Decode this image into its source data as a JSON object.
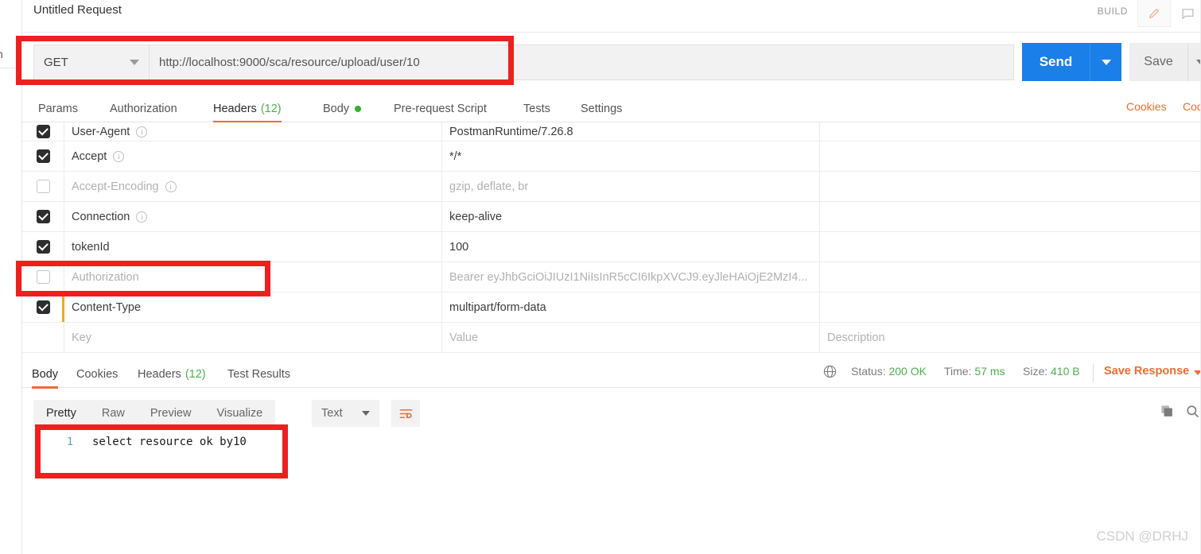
{
  "app": {
    "request_title": "Untitled Request",
    "build_label": "BUILD",
    "watermark": "CSDN @DRHJ",
    "rail_text": "n",
    "accent_orange": "#ef6c34",
    "accent_blue": "#1a7fe8",
    "accent_green": "#4caf50",
    "annotation_red": "#f01f1f"
  },
  "url_bar": {
    "method": "GET",
    "url": "http://localhost:9000/sca/resource/upload/user/10",
    "send_label": "Send",
    "save_label": "Save"
  },
  "request_tabs": [
    {
      "label": "Params",
      "active": false,
      "count": "",
      "dot": false
    },
    {
      "label": "Authorization",
      "active": false,
      "count": "",
      "dot": false
    },
    {
      "label": "Headers",
      "active": true,
      "count": "(12)",
      "dot": false
    },
    {
      "label": "Body",
      "active": false,
      "count": "",
      "dot": true
    },
    {
      "label": "Pre-request Script",
      "active": false,
      "count": "",
      "dot": false
    },
    {
      "label": "Tests",
      "active": false,
      "count": "",
      "dot": false
    },
    {
      "label": "Settings",
      "active": false,
      "count": "",
      "dot": false
    }
  ],
  "right_links": [
    {
      "label": "Cookies"
    },
    {
      "label": "Cod"
    }
  ],
  "headers_table": {
    "columns": {
      "key": "Key",
      "value": "Value",
      "description": "Description"
    },
    "rows": [
      {
        "key": "User-Agent",
        "value": "PostmanRuntime/7.26.8",
        "checked": true,
        "info": true,
        "muted": false,
        "marker": false
      },
      {
        "key": "Accept",
        "value": "*/*",
        "checked": true,
        "info": true,
        "muted": false,
        "marker": false
      },
      {
        "key": "Accept-Encoding",
        "value": "gzip, deflate, br",
        "checked": false,
        "info": true,
        "muted": true,
        "marker": false
      },
      {
        "key": "Connection",
        "value": "keep-alive",
        "checked": true,
        "info": true,
        "muted": false,
        "marker": false
      },
      {
        "key": "tokenId",
        "value": "100",
        "checked": true,
        "info": false,
        "muted": false,
        "marker": false
      },
      {
        "key": "Authorization",
        "value": "Bearer eyJhbGciOiJIUzI1NiIsInR5cCI6IkpXVCJ9.eyJleHAiOjE2MzI4...",
        "checked": false,
        "info": false,
        "muted": true,
        "marker": false
      },
      {
        "key": "Content-Type",
        "value": "multipart/form-data",
        "checked": true,
        "info": false,
        "muted": false,
        "marker": true
      }
    ]
  },
  "response_tabs": [
    {
      "label": "Body",
      "active": true,
      "count": ""
    },
    {
      "label": "Cookies",
      "active": false,
      "count": ""
    },
    {
      "label": "Headers",
      "active": false,
      "count": "(12)"
    },
    {
      "label": "Test Results",
      "active": false,
      "count": ""
    }
  ],
  "response_meta": {
    "status_label": "Status:",
    "status_value": "200 OK",
    "time_label": "Time:",
    "time_value": "57 ms",
    "size_label": "Size:",
    "size_value": "410 B",
    "save_response": "Save Response"
  },
  "body_toolbar": {
    "tabs": [
      {
        "label": "Pretty",
        "active": true
      },
      {
        "label": "Raw",
        "active": false
      },
      {
        "label": "Preview",
        "active": false
      },
      {
        "label": "Visualize",
        "active": false
      }
    ],
    "format": "Text"
  },
  "response_body": {
    "lines": [
      {
        "no": "1",
        "text": "select resource ok by10"
      }
    ]
  }
}
